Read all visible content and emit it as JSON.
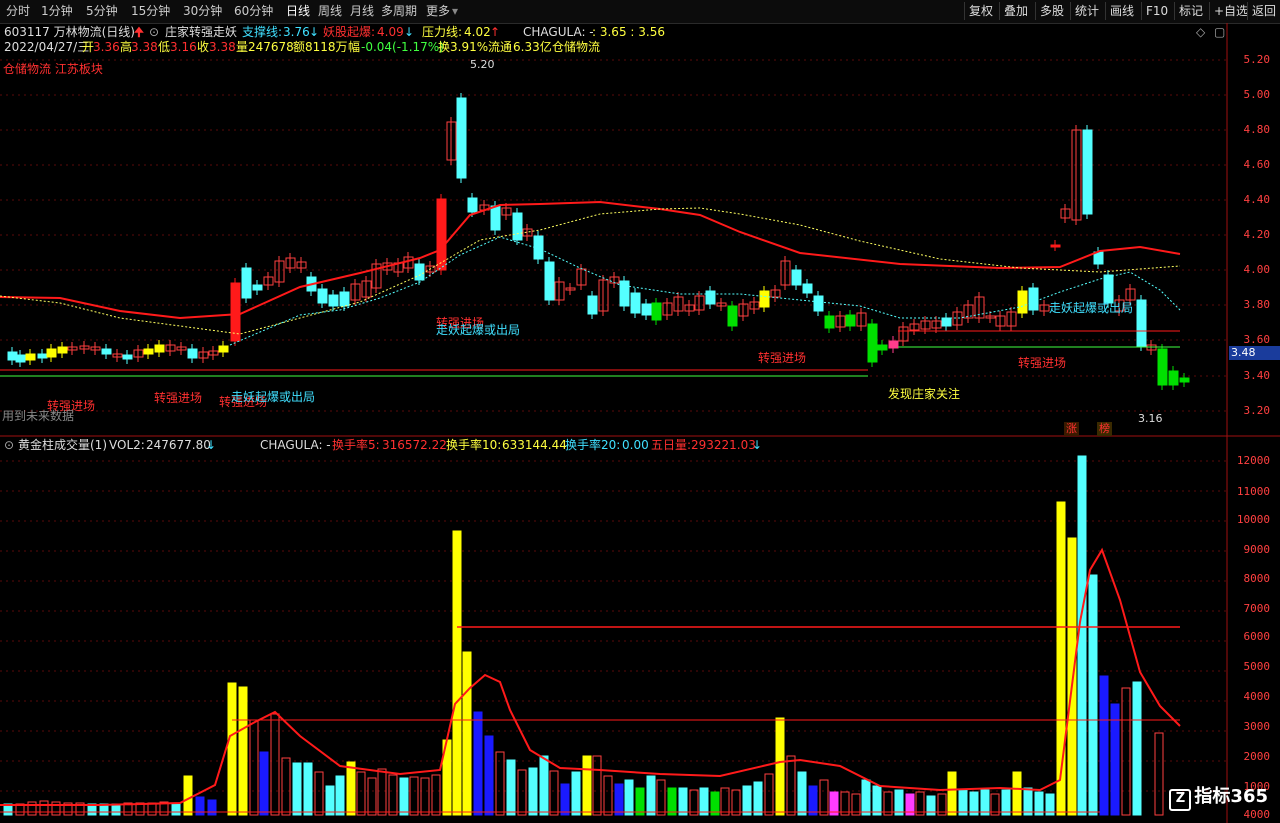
{
  "toolbar": {
    "periods": [
      "分时",
      "1分钟",
      "5分钟",
      "15分钟",
      "30分钟",
      "60分钟",
      "日线",
      "周线",
      "月线",
      "多周期",
      "更多"
    ],
    "active_period": "日线",
    "right_buttons": [
      "复权",
      "叠加",
      "多股",
      "统计",
      "画线",
      "F10",
      "标记",
      "+自选",
      "返回"
    ]
  },
  "header": {
    "code_name": "603117 万林物流(日线)",
    "indicator_name": "庄家转强走妖",
    "support_label": "支撑线:",
    "support_value": "3.76",
    "demon_label": "妖股起爆:",
    "demon_value": "4.09",
    "pressure_label": "压力线:",
    "pressure_value": "4.02",
    "chagula": "CHAGULA: -",
    "price_values": ": 3.65 : 3.56"
  },
  "quote": {
    "date": "2022/04/27/三",
    "open_label": "开",
    "open": "3.36",
    "high_label": "高",
    "high": "3.38",
    "low_label": "低",
    "low": "3.16",
    "close_label": "收",
    "close": "3.38",
    "vol_label": "量",
    "volume": "247678",
    "amount_label": "额",
    "amount": "8118万",
    "change_label": "幅",
    "change": "-0.04(-1.17%)",
    "turnover_label": "换",
    "turnover": "3.91%",
    "float_label": "流通",
    "float_value": "6.33亿",
    "sector": "仓储物流"
  },
  "sector_line": "仓储物流 江苏板块",
  "price_axis": [
    "5.20",
    "5.00",
    "4.80",
    "4.60",
    "4.40",
    "4.20",
    "4.00",
    "3.80",
    "3.60",
    "3.40",
    "3.20"
  ],
  "last_price": "3.48",
  "max_label": "5.20",
  "min_label": "3.16",
  "annotations": [
    {
      "text": "转强进场",
      "color": "#ff3030"
    },
    {
      "text": "转强进场",
      "color": "#ff3030"
    },
    {
      "text": "转强进场",
      "color": "#ff3030"
    },
    {
      "text": "走妖起爆或出局",
      "color": "#40e0ff"
    },
    {
      "text": "转强进场",
      "color": "#ff3030"
    },
    {
      "text": "走妖起爆或出局",
      "color": "#40e0ff"
    },
    {
      "text": "转强进场",
      "color": "#ff3030"
    },
    {
      "text": "发现庄家关注",
      "color": "#ffff40"
    },
    {
      "text": "转强进场",
      "color": "#ff3030"
    },
    {
      "text": "走妖起爆或出局",
      "color": "#40e0ff"
    }
  ],
  "no_future_data": "用到未来数据",
  "badges": [
    "涨",
    "榜"
  ],
  "volume_panel": {
    "title": "黄金柱成交量(1)",
    "vol2_label": "VOL2:",
    "vol2_value": "247677.80",
    "chagula": "CHAGULA: -",
    "hs5_label": "换手率5:",
    "hs5_value": "316572.22",
    "hs10_label": "换手率10:",
    "hs10_value": "633144.44",
    "hs20_label": "换手率20:",
    "hs20_value": "0.00",
    "wu_label": "五日量:",
    "wu_value": "293221.03",
    "axis": [
      "12000",
      "11000",
      "10000",
      "9000",
      "8000",
      "7000",
      "6000",
      "5000",
      "4000",
      "3000",
      "2000",
      "1000",
      "4000"
    ]
  },
  "logo": "指标365",
  "colors": {
    "up": "#ff3232",
    "down": "#54ffff",
    "ma_red": "#ff2020",
    "yellow": "#ffff00",
    "blue": "#1a1aff"
  }
}
